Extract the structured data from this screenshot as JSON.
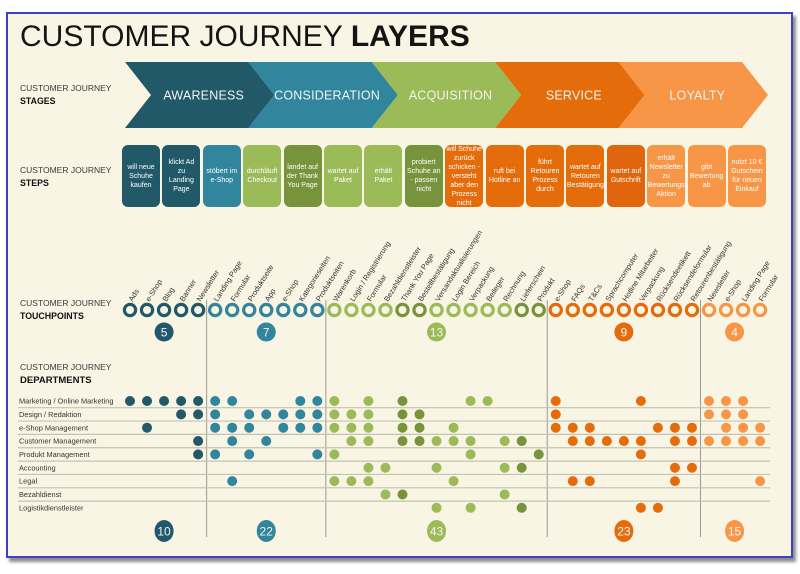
{
  "title": {
    "light": "CUSTOMER JOURNEY",
    "bold": "LAYERS"
  },
  "section_labels": {
    "stages": {
      "prefix": "CUSTOMER JOURNEY",
      "name": "STAGES"
    },
    "steps": {
      "prefix": "CUSTOMER JOURNEY",
      "name": "STEPS"
    },
    "touchpoints": {
      "prefix": "CUSTOMER JOURNEY",
      "name": "TOUCHPOINTS"
    },
    "departments": {
      "prefix": "CUSTOMER JOURNEY",
      "name": "DEPARTMENTS"
    }
  },
  "stages": [
    {
      "name": "AWARENESS",
      "color": "#215968",
      "touchpoint_count": "5",
      "department_total": "10"
    },
    {
      "name": "CONSIDERATION",
      "color": "#31859c",
      "touchpoint_count": "7",
      "department_total": "22"
    },
    {
      "name": "ACQUISITION",
      "color": "#9bbb59",
      "touchpoint_count": "13",
      "department_total": "43"
    },
    {
      "name": "SERVICE",
      "color": "#e46c0a",
      "touchpoint_count": "9",
      "department_total": "23"
    },
    {
      "name": "LOYALTY",
      "color": "#f79646",
      "touchpoint_count": "4",
      "department_total": "15"
    }
  ],
  "colors": {
    "awareness": "#215968",
    "consideration": "#31859c",
    "acquisition": "#9bbb59",
    "acquisition_emphasis": "#77933c",
    "service": "#e46c0a",
    "loyalty": "#f79646"
  },
  "steps": [
    {
      "text": "will neue\nSchuhe\nkaufen",
      "color": "#215968"
    },
    {
      "text": "klickt Ad\nzu\nLanding\nPage",
      "color": "#215968"
    },
    {
      "text": "stöbert im\ne-Shop",
      "color": "#31859c"
    },
    {
      "text": "durchläuft\nCheckout",
      "color": "#9bbb59"
    },
    {
      "text": "landet auf\nder Thank\nYou Page",
      "color": "#77933c"
    },
    {
      "text": "wartet auf\nPaket",
      "color": "#9bbb59"
    },
    {
      "text": "erhält\nPaket",
      "color": "#9bbb59"
    },
    {
      "text": "probiert\nSchuhe an\n- passen\nnicht",
      "color": "#77933c"
    },
    {
      "text": "will Schuhe\nzurück\nschicken -\nversteht\naber den\nProzess\nnicht",
      "color": "#e46c0a"
    },
    {
      "text": "ruft bei\nHotline an",
      "color": "#e46c0a"
    },
    {
      "text": "führt\nRetouren\nProzess\ndurch",
      "color": "#e46c0a"
    },
    {
      "text": "wartet auf\nRetouren\nBestätigung",
      "color": "#e46c0a"
    },
    {
      "text": "wartet auf\nGutschrift",
      "color": "#e0650c"
    },
    {
      "text": "erhält\nNewsletter\nzu\nBewertungs\nAktion",
      "color": "#f79646"
    },
    {
      "text": "gibt\nBewertung\nab",
      "color": "#f79646"
    },
    {
      "text": "nutzt 10 €\nGutschein\nfür neuen\nEinkauf",
      "color": "#f79646"
    }
  ],
  "touchpoints": [
    {
      "label": "Ads",
      "stage": 0,
      "color": "#215968"
    },
    {
      "label": "e-Shop",
      "stage": 0,
      "color": "#215968"
    },
    {
      "label": "Blog",
      "stage": 0,
      "color": "#215968"
    },
    {
      "label": "Banner",
      "stage": 0,
      "color": "#215968"
    },
    {
      "label": "Newsletter",
      "stage": 0,
      "color": "#215968"
    },
    {
      "label": "Landing Page",
      "stage": 1,
      "color": "#31859c"
    },
    {
      "label": "Formular",
      "stage": 1,
      "color": "#31859c"
    },
    {
      "label": "Produktseite",
      "stage": 1,
      "color": "#31859c"
    },
    {
      "label": "App",
      "stage": 1,
      "color": "#31859c"
    },
    {
      "label": "e-Shop",
      "stage": 1,
      "color": "#31859c"
    },
    {
      "label": "Kategorieseiten",
      "stage": 1,
      "color": "#31859c"
    },
    {
      "label": "Produktseiten",
      "stage": 1,
      "color": "#31859c"
    },
    {
      "label": "Warenkorb",
      "stage": 2,
      "color": "#9bbb59"
    },
    {
      "label": "Login / Registrierung",
      "stage": 2,
      "color": "#9bbb59"
    },
    {
      "label": "Formular",
      "stage": 2,
      "color": "#9bbb59"
    },
    {
      "label": "Bezahldienstleister",
      "stage": 2,
      "color": "#9bbb59"
    },
    {
      "label": "Thank You Page",
      "stage": 2,
      "color": "#77933c"
    },
    {
      "label": "Bestellbestätigung",
      "stage": 2,
      "color": "#77933c"
    },
    {
      "label": "Versandaktualisierungen",
      "stage": 2,
      "color": "#9bbb59"
    },
    {
      "label": "Login Bereich",
      "stage": 2,
      "color": "#9bbb59"
    },
    {
      "label": "Verpackung",
      "stage": 2,
      "color": "#9bbb59"
    },
    {
      "label": "Beileger",
      "stage": 2,
      "color": "#9bbb59"
    },
    {
      "label": "Rechnung",
      "stage": 2,
      "color": "#9bbb59"
    },
    {
      "label": "Lieferschein",
      "stage": 2,
      "color": "#77933c"
    },
    {
      "label": "Produkt",
      "stage": 2,
      "color": "#77933c"
    },
    {
      "label": "e-Shop",
      "stage": 3,
      "color": "#e46c0a"
    },
    {
      "label": "FAQs",
      "stage": 3,
      "color": "#e46c0a"
    },
    {
      "label": "T&Cs",
      "stage": 3,
      "color": "#e46c0a"
    },
    {
      "label": "Sprachcomputer",
      "stage": 3,
      "color": "#e46c0a"
    },
    {
      "label": "Hotline Mitarbeiter",
      "stage": 3,
      "color": "#e46c0a"
    },
    {
      "label": "Verpackung",
      "stage": 3,
      "color": "#e46c0a"
    },
    {
      "label": "Rücksendeetikett",
      "stage": 3,
      "color": "#e46c0a"
    },
    {
      "label": "Rücksendeformular",
      "stage": 3,
      "color": "#e46c0a"
    },
    {
      "label": "Retourenbestätigung",
      "stage": 3,
      "color": "#e46c0a"
    },
    {
      "label": "Newsletter",
      "stage": 4,
      "color": "#f79646"
    },
    {
      "label": "e-Shop",
      "stage": 4,
      "color": "#f79646"
    },
    {
      "label": "Landing Page",
      "stage": 4,
      "color": "#f79646"
    },
    {
      "label": "Formular",
      "stage": 4,
      "color": "#f79646"
    }
  ],
  "departments": [
    {
      "name": "Marketing / Online Marketing",
      "touchpoints": [
        0,
        1,
        2,
        3,
        4,
        5,
        6,
        10,
        11,
        12,
        14,
        16,
        20,
        21,
        25,
        30,
        34,
        35,
        36
      ]
    },
    {
      "name": "Design / Redaktion",
      "touchpoints": [
        3,
        4,
        5,
        7,
        8,
        9,
        10,
        11,
        12,
        13,
        14,
        16,
        17,
        25,
        34,
        35,
        36
      ]
    },
    {
      "name": "e-Shop Management",
      "touchpoints": [
        1,
        5,
        6,
        7,
        9,
        10,
        11,
        12,
        13,
        14,
        16,
        17,
        19,
        25,
        26,
        27,
        31,
        32,
        33,
        35,
        36,
        37
      ]
    },
    {
      "name": "Customer Management",
      "touchpoints": [
        4,
        6,
        8,
        13,
        14,
        16,
        17,
        18,
        19,
        20,
        22,
        23,
        26,
        27,
        28,
        29,
        30,
        32,
        33,
        34,
        35,
        36,
        37
      ]
    },
    {
      "name": "Produkt Management",
      "touchpoints": [
        4,
        5,
        7,
        11,
        12,
        20,
        24,
        30
      ]
    },
    {
      "name": "Accounting",
      "touchpoints": [
        14,
        15,
        18,
        22,
        23,
        32,
        33
      ]
    },
    {
      "name": "Legal",
      "touchpoints": [
        6,
        12,
        13,
        14,
        19,
        26,
        27,
        32,
        37
      ]
    },
    {
      "name": "Bezahldienst",
      "touchpoints": [
        15,
        16,
        22
      ]
    },
    {
      "name": "Logistikdienstleister",
      "touchpoints": [
        18,
        20,
        23,
        30,
        31
      ]
    }
  ]
}
